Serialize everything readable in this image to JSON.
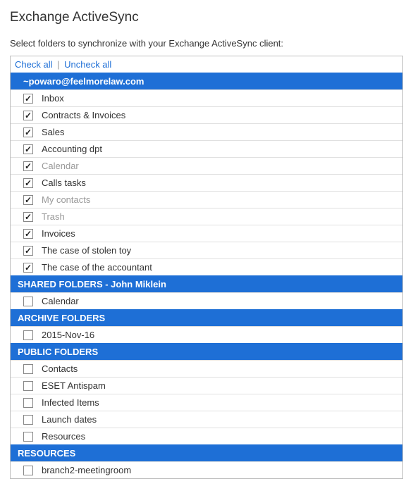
{
  "title": "Exchange ActiveSync",
  "instruction": "Select folders to synchronize with your Exchange ActiveSync client:",
  "check_all_label": "Check all",
  "uncheck_all_label": "Uncheck all",
  "separator": "|",
  "sections": [
    {
      "header": "~powaro@feelmorelaw.com",
      "indented": true,
      "folders": [
        {
          "label": "Inbox",
          "checked": true,
          "dimmed": false
        },
        {
          "label": "Contracts & Invoices",
          "checked": true,
          "dimmed": false
        },
        {
          "label": "Sales",
          "checked": true,
          "dimmed": false
        },
        {
          "label": "Accounting dpt",
          "checked": true,
          "dimmed": false
        },
        {
          "label": "Calendar",
          "checked": true,
          "dimmed": true
        },
        {
          "label": "Calls tasks",
          "checked": true,
          "dimmed": false
        },
        {
          "label": "My contacts",
          "checked": true,
          "dimmed": true
        },
        {
          "label": "Trash",
          "checked": true,
          "dimmed": true
        },
        {
          "label": "Invoices",
          "checked": true,
          "dimmed": false
        },
        {
          "label": "The case of stolen toy",
          "checked": true,
          "dimmed": false
        },
        {
          "label": "The case of the accountant",
          "checked": true,
          "dimmed": false
        }
      ]
    },
    {
      "header": "SHARED FOLDERS - John Miklein",
      "indented": false,
      "folders": [
        {
          "label": "Calendar",
          "checked": false,
          "dimmed": false
        }
      ]
    },
    {
      "header": "ARCHIVE FOLDERS",
      "indented": false,
      "folders": [
        {
          "label": "2015-Nov-16",
          "checked": false,
          "dimmed": false
        }
      ]
    },
    {
      "header": "PUBLIC FOLDERS",
      "indented": false,
      "folders": [
        {
          "label": "Contacts",
          "checked": false,
          "dimmed": false
        },
        {
          "label": "ESET Antispam",
          "checked": false,
          "dimmed": false
        },
        {
          "label": "Infected Items",
          "checked": false,
          "dimmed": false
        },
        {
          "label": "Launch dates",
          "checked": false,
          "dimmed": false
        },
        {
          "label": "Resources",
          "checked": false,
          "dimmed": false
        }
      ]
    },
    {
      "header": "RESOURCES",
      "indented": false,
      "folders": [
        {
          "label": "branch2-meetingroom",
          "checked": false,
          "dimmed": false
        }
      ]
    }
  ]
}
